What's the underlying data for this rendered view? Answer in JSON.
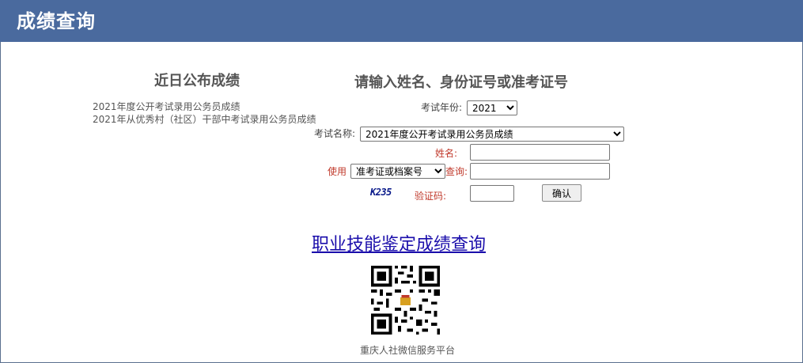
{
  "header": {
    "title": "成绩查询"
  },
  "left": {
    "title": "近日公布成绩",
    "items": [
      "2021年度公开考试录用公务员成绩",
      "2021年从优秀村（社区）干部中考试录用公务员成绩"
    ]
  },
  "form": {
    "title": "请输入姓名、身份证号或准考证号",
    "year_label": "考试年份:",
    "year_value": "2021",
    "exam_label": "考试名称:",
    "exam_value": "2021年度公开考试录用公务员成绩",
    "name_label": "姓名:",
    "use_label": "使用",
    "use_value": "准考证或档案号",
    "query_label": "查询:",
    "captcha_image_text": "K235",
    "captcha_label": "验证码:",
    "confirm_button": "确认"
  },
  "vocational_link": "职业技能鉴定成绩查询",
  "qr": {
    "caption": "重庆人社微信服务平台",
    "icon": "qr-code-icon"
  },
  "colors": {
    "header_bg": "#4a6a9e",
    "red_label": "#c0392b",
    "link": "#1a0dab"
  }
}
